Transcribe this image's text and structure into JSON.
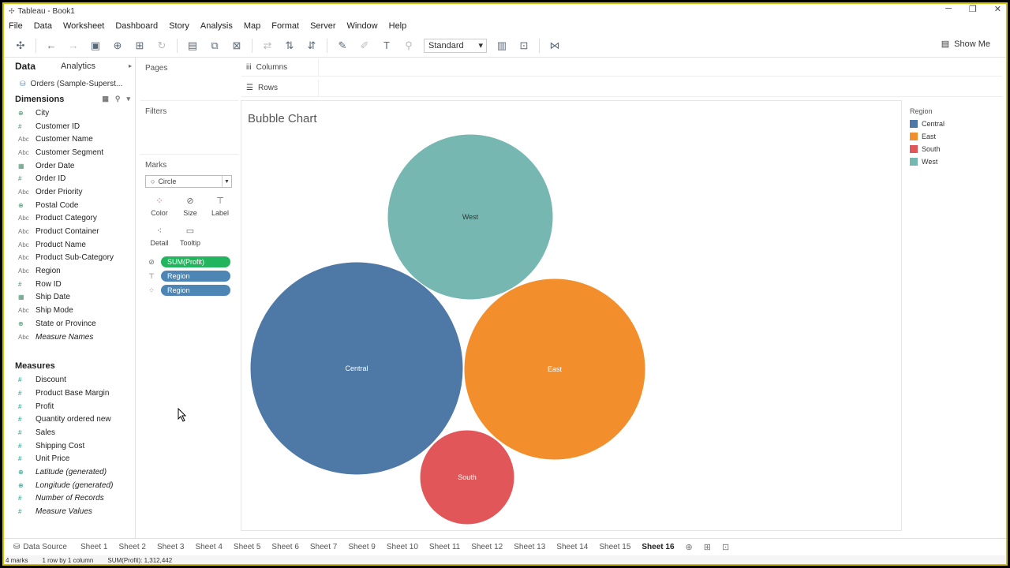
{
  "window": {
    "title": "Tableau - Book1"
  },
  "menu": [
    "File",
    "Data",
    "Worksheet",
    "Dashboard",
    "Story",
    "Analysis",
    "Map",
    "Format",
    "Server",
    "Window",
    "Help"
  ],
  "toolbar": {
    "fit_select": "Standard",
    "show_me": "Show Me"
  },
  "datapane": {
    "tab_data": "Data",
    "tab_analytics": "Analytics",
    "datasource": "Orders (Sample-Superst...",
    "dimensions_title": "Dimensions",
    "dimensions": [
      {
        "type": "geo",
        "name": "City"
      },
      {
        "type": "num",
        "name": "Customer ID"
      },
      {
        "type": "abc",
        "name": "Customer Name"
      },
      {
        "type": "abc",
        "name": "Customer Segment"
      },
      {
        "type": "date",
        "name": "Order Date"
      },
      {
        "type": "num",
        "name": "Order ID"
      },
      {
        "type": "abc",
        "name": "Order Priority"
      },
      {
        "type": "geo",
        "name": "Postal Code"
      },
      {
        "type": "abc",
        "name": "Product Category"
      },
      {
        "type": "abc",
        "name": "Product Container"
      },
      {
        "type": "abc",
        "name": "Product Name"
      },
      {
        "type": "abc",
        "name": "Product Sub-Category"
      },
      {
        "type": "abc",
        "name": "Region"
      },
      {
        "type": "num",
        "name": "Row ID"
      },
      {
        "type": "date",
        "name": "Ship Date"
      },
      {
        "type": "abc",
        "name": "Ship Mode"
      },
      {
        "type": "geo",
        "name": "State or Province"
      },
      {
        "type": "abc",
        "name": "Measure Names"
      }
    ],
    "measures_title": "Measures",
    "measures": [
      {
        "type": "num",
        "name": "Discount"
      },
      {
        "type": "num",
        "name": "Product Base Margin"
      },
      {
        "type": "num",
        "name": "Profit"
      },
      {
        "type": "num",
        "name": "Quantity ordered new"
      },
      {
        "type": "num",
        "name": "Sales"
      },
      {
        "type": "num",
        "name": "Shipping Cost"
      },
      {
        "type": "num",
        "name": "Unit Price"
      },
      {
        "type": "geo",
        "name": "Latitude (generated)"
      },
      {
        "type": "geo",
        "name": "Longitude (generated)"
      },
      {
        "type": "num",
        "name": "Number of Records"
      },
      {
        "type": "num",
        "name": "Measure Values"
      }
    ]
  },
  "cards": {
    "pages": "Pages",
    "filters": "Filters",
    "marks": "Marks",
    "mark_type": "Circle",
    "mark_buttons": [
      "Color",
      "Size",
      "Label",
      "Detail",
      "Tooltip"
    ],
    "pills": [
      {
        "label": "SUM(Profit)",
        "color": "#22b55d"
      },
      {
        "label": "Region",
        "color": "#4d86b5"
      },
      {
        "label": "Region",
        "color": "#4d86b5"
      }
    ]
  },
  "shelves": {
    "columns": "Columns",
    "rows": "Rows"
  },
  "viz": {
    "title": "Bubble Chart"
  },
  "chart_data": {
    "type": "scatter",
    "title": "Bubble Chart",
    "size_field": "SUM(Profit)",
    "color_field": "Region",
    "bubbles": [
      {
        "label": "Central",
        "color": "#4e79a7"
      },
      {
        "label": "West",
        "color": "#76b7b2"
      },
      {
        "label": "East",
        "color": "#f28e2b"
      },
      {
        "label": "South",
        "color": "#e15759"
      }
    ]
  },
  "legend": {
    "title": "Region",
    "items": [
      {
        "label": "Central",
        "color": "#4e79a7"
      },
      {
        "label": "East",
        "color": "#f28e2b"
      },
      {
        "label": "South",
        "color": "#e15759"
      },
      {
        "label": "West",
        "color": "#76b7b2"
      }
    ]
  },
  "tabs": {
    "datasource": "Data Source",
    "sheets": [
      "Sheet 1",
      "Sheet 2",
      "Sheet 3",
      "Sheet 4",
      "Sheet 5",
      "Sheet 6",
      "Sheet 7",
      "Sheet 9",
      "Sheet 10",
      "Sheet 11",
      "Sheet 12",
      "Sheet 13",
      "Sheet 14",
      "Sheet 15",
      "Sheet 16"
    ],
    "active": "Sheet 16"
  },
  "status": {
    "marks": "4 marks",
    "rows_cols": "1 row by 1 column",
    "sum": "SUM(Profit): 1,312,442"
  }
}
